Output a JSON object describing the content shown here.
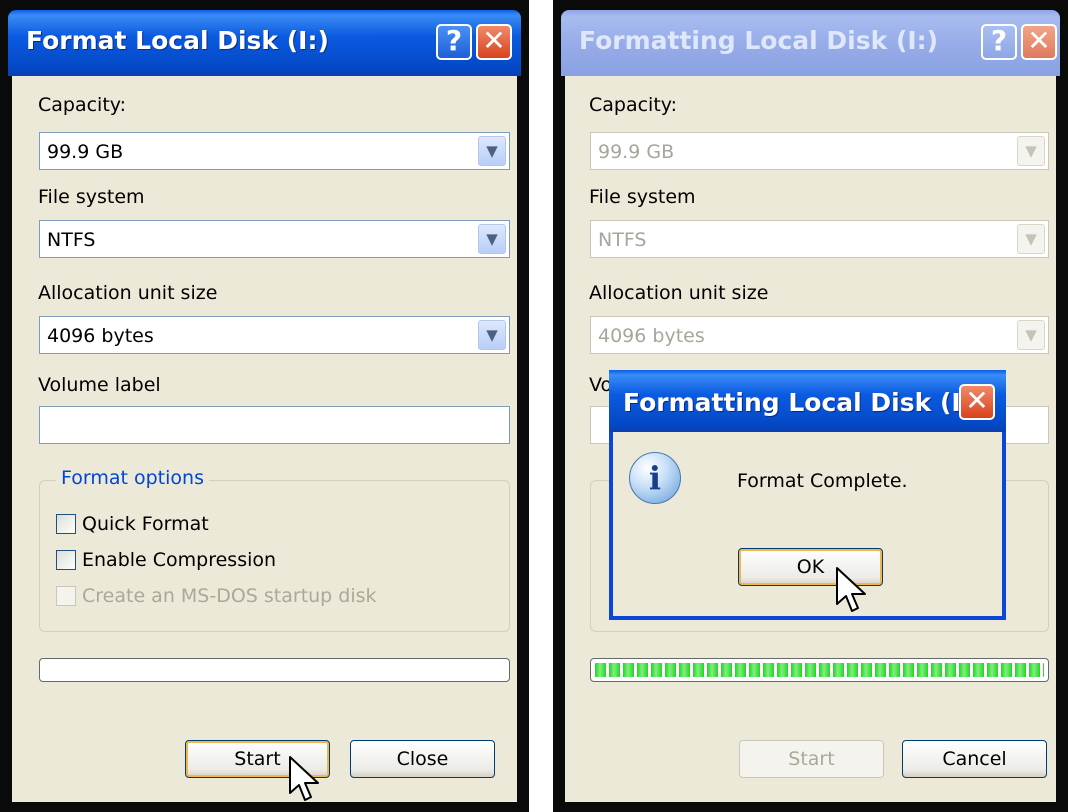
{
  "left_dialog": {
    "title": "Format Local Disk (I:)",
    "help_glyph": "?",
    "close_glyph": "✕",
    "capacity_label": "Capacity:",
    "capacity_value": "99.9 GB",
    "file_system_label": "File system",
    "file_system_value": "NTFS",
    "allocation_label": "Allocation unit size",
    "allocation_value": "4096 bytes",
    "volume_label": "Volume label",
    "volume_value": "",
    "format_options_title": "Format options",
    "quick_format": "Quick Format",
    "enable_compression": "Enable Compression",
    "msdos_startup": "Create an MS-DOS startup disk",
    "progress_percent": 0,
    "start_button": "Start",
    "close_button": "Close"
  },
  "right_dialog": {
    "title": "Formatting Local Disk (I:)",
    "help_glyph": "?",
    "close_glyph": "✕",
    "capacity_label": "Capacity:",
    "capacity_value": "99.9 GB",
    "file_system_label": "File system",
    "file_system_value": "NTFS",
    "allocation_label": "Allocation unit size",
    "allocation_value": "4096 bytes",
    "volume_label_partial": "Vo",
    "progress_percent": 100,
    "start_button": "Start",
    "cancel_button": "Cancel"
  },
  "message_box": {
    "title": "Formatting Local Disk (I:)",
    "close_glyph": "✕",
    "icon": "info-icon",
    "icon_glyph": "i",
    "message": "Format Complete.",
    "ok_button": "OK"
  },
  "colors": {
    "title_active": "#0a5ae0",
    "title_inactive": "#97ade9",
    "dialog_face": "#ece9d8",
    "group_title": "#0046d5",
    "progress_green": "#27d227"
  }
}
